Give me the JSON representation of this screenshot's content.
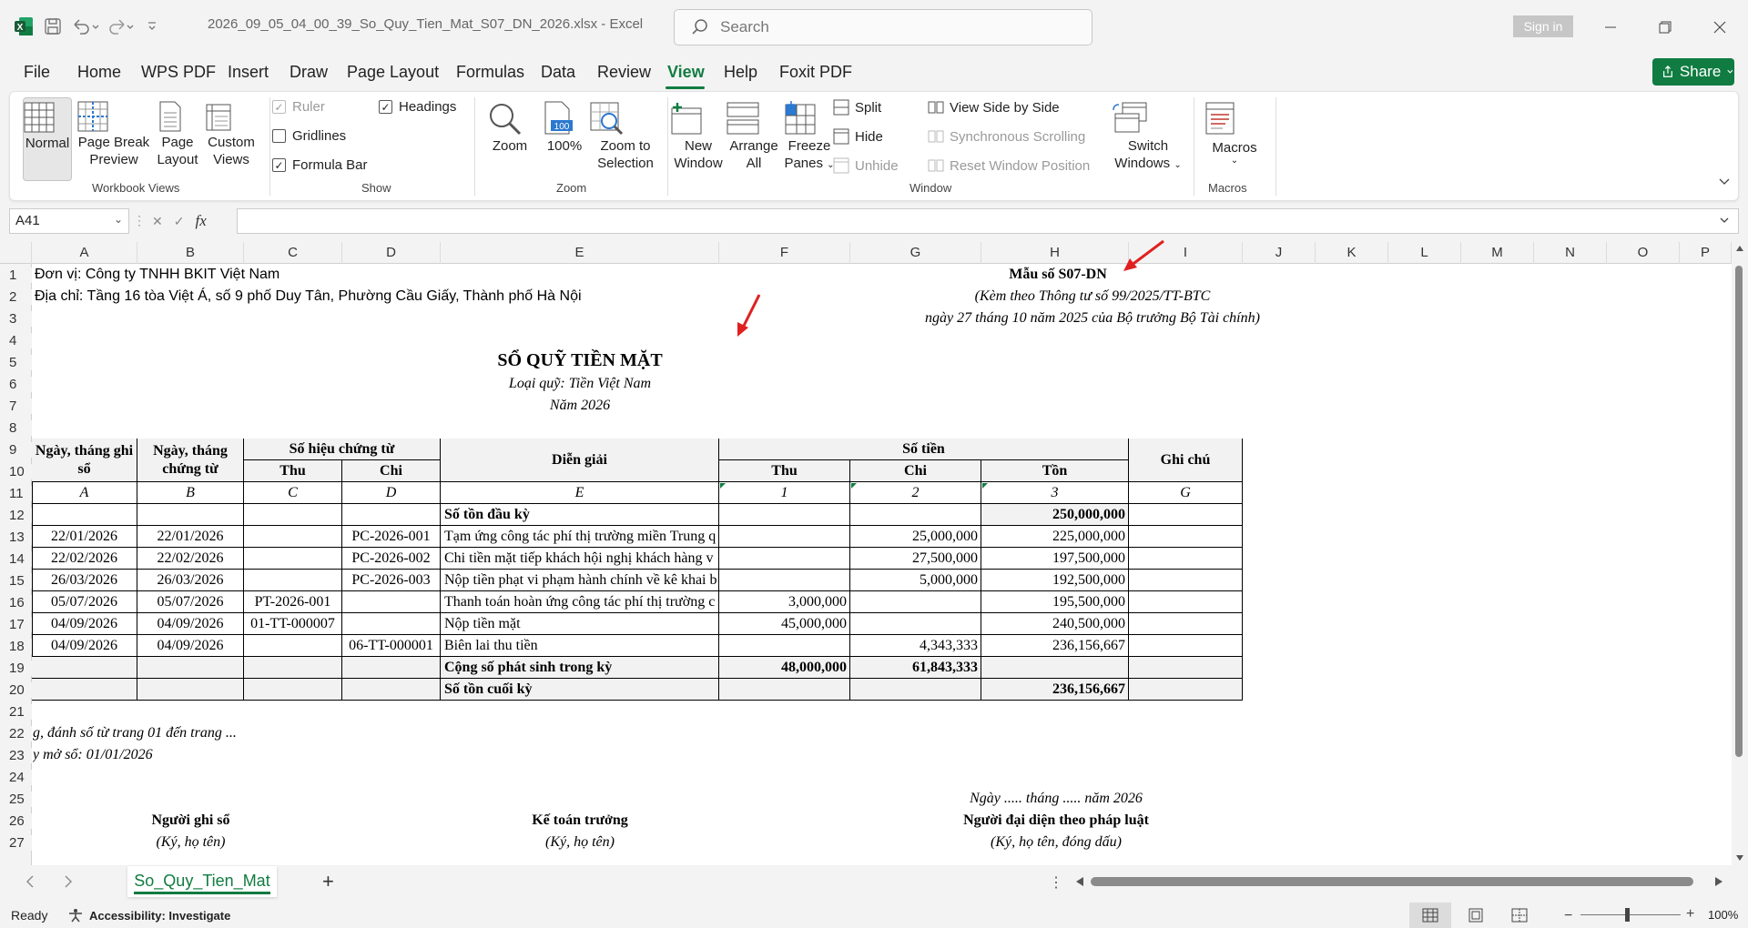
{
  "titlebar": {
    "doc_title": "2026_09_05_04_00_39_So_Quy_Tien_Mat_S07_DN_2026.xlsx  -  Excel",
    "search_placeholder": "Search",
    "sign_in": "Sign in"
  },
  "menu": {
    "items": [
      "File",
      "Home",
      "WPS PDF",
      "Insert",
      "Draw",
      "Page Layout",
      "Formulas",
      "Data",
      "Review",
      "View",
      "Help",
      "Foxit PDF"
    ],
    "active": "View",
    "share": "Share"
  },
  "ribbon": {
    "workbook_views": {
      "label": "Workbook Views",
      "normal": "Normal",
      "page_break_1": "Page Break",
      "page_break_2": "Preview",
      "page_layout_1": "Page",
      "page_layout_2": "Layout",
      "custom_1": "Custom",
      "custom_2": "Views"
    },
    "show": {
      "label": "Show",
      "ruler": "Ruler",
      "gridlines": "Gridlines",
      "formula_bar": "Formula Bar",
      "headings": "Headings"
    },
    "zoom": {
      "label": "Zoom",
      "zoom": "Zoom",
      "hundred": "100%",
      "zoom_sel_1": "Zoom to",
      "zoom_sel_2": "Selection"
    },
    "window": {
      "label": "Window",
      "new_1": "New",
      "new_2": "Window",
      "arrange_1": "Arrange",
      "arrange_2": "All",
      "freeze_1": "Freeze",
      "freeze_2": "Panes",
      "split": "Split",
      "hide": "Hide",
      "unhide": "Unhide",
      "side_by_side": "View Side by Side",
      "sync_scroll": "Synchronous Scrolling",
      "reset_pos": "Reset Window Position",
      "switch_1": "Switch",
      "switch_2": "Windows"
    },
    "macros": {
      "label": "Macros",
      "macros": "Macros"
    }
  },
  "formula_bar": {
    "name_box": "A41",
    "fx": "fx",
    "content": ""
  },
  "columns": [
    "A",
    "B",
    "C",
    "D",
    "E",
    "F",
    "G",
    "H",
    "I",
    "J",
    "K",
    "L",
    "M",
    "N",
    "O",
    "P"
  ],
  "rows": [
    "1",
    "2",
    "3",
    "4",
    "5",
    "6",
    "7",
    "8",
    "9",
    "10",
    "11",
    "12",
    "13",
    "14",
    "15",
    "16",
    "17",
    "18",
    "19",
    "20",
    "21",
    "22",
    "23",
    "24",
    "25",
    "26",
    "27"
  ],
  "sheet": {
    "unit": "Đơn vị: Công ty TNHH BKIT Việt Nam",
    "address": "Địa chỉ: Tầng 16 tòa Việt Á, số 9 phố Duy Tân, Phường Cầu Giấy, Thành phố Hà Nội",
    "form_no": "Mẫu số S07-DN",
    "circular": "(Kèm theo Thông tư số 99/2025/TT-BTC",
    "circular_date": "ngày 27 tháng 10 năm 2025 của Bộ trưởng Bộ Tài chính)",
    "title": "SỔ QUỸ TIỀN MẶT",
    "fund_type": "Loại quỹ: Tiền Việt Nam",
    "year": "Năm 2026",
    "headers": {
      "date_rec": "Ngày, tháng ghi sổ",
      "date_doc": "Ngày, tháng chứng từ",
      "doc_no": "Số hiệu chứng từ",
      "receipt": "Thu",
      "payment": "Chi",
      "desc": "Diễn giải",
      "amount": "Số tiền",
      "in": "Thu",
      "out": "Chi",
      "balance": "Tồn",
      "note": "Ghi chú"
    },
    "codes": [
      "A",
      "B",
      "C",
      "D",
      "E",
      "1",
      "2",
      "3",
      "G"
    ],
    "opening": {
      "label": "Số tồn đầu kỳ",
      "balance": "250,000,000"
    },
    "entries": [
      {
        "date_rec": "22/01/2026",
        "date_doc": "22/01/2026",
        "thu_no": "",
        "chi_no": "PC-2026-001",
        "desc": "Tạm ứng công tác phí thị trường miền Trung q",
        "in": "",
        "out": "25,000,000",
        "bal": "225,000,000"
      },
      {
        "date_rec": "22/02/2026",
        "date_doc": "22/02/2026",
        "thu_no": "",
        "chi_no": "PC-2026-002",
        "desc": "Chi tiền mặt tiếp khách hội nghị khách hàng v",
        "in": "",
        "out": "27,500,000",
        "bal": "197,500,000"
      },
      {
        "date_rec": "26/03/2026",
        "date_doc": "26/03/2026",
        "thu_no": "",
        "chi_no": "PC-2026-003",
        "desc": "Nộp tiền phạt vi phạm hành chính về kê khai b",
        "in": "",
        "out": "5,000,000",
        "bal": "192,500,000"
      },
      {
        "date_rec": "05/07/2026",
        "date_doc": "05/07/2026",
        "thu_no": "PT-2026-001",
        "chi_no": "",
        "desc": "Thanh toán hoàn ứng công tác phí thị trường c",
        "in": "3,000,000",
        "out": "",
        "bal": "195,500,000"
      },
      {
        "date_rec": "04/09/2026",
        "date_doc": "04/09/2026",
        "thu_no": "01-TT-000007",
        "chi_no": "",
        "desc": "Nộp tiền mặt",
        "in": "45,000,000",
        "out": "",
        "bal": "240,500,000"
      },
      {
        "date_rec": "04/09/2026",
        "date_doc": "04/09/2026",
        "thu_no": "",
        "chi_no": "06-TT-000001",
        "desc": "Biên lai thu tiền",
        "in": "",
        "out": "4,343,333",
        "bal": "236,156,667"
      }
    ],
    "total": {
      "label": "Cộng số phát sinh trong kỳ",
      "in": "48,000,000",
      "out": "61,843,333"
    },
    "closing": {
      "label": "Số tồn cuối kỳ",
      "balance": "236,156,667"
    },
    "note_pages": "g, đánh số từ trang 01 đến trang ...",
    "note_open": "y mở sổ: 01/01/2026",
    "date_line": "Ngày ..... tháng ..... năm 2026",
    "sig1": "Người ghi sổ",
    "sig1_sub": "(Ký, họ tên)",
    "sig2": "Kế toán trưởng",
    "sig2_sub": "(Ký, họ tên)",
    "sig3": "Người đại diện theo pháp luật",
    "sig3_sub": "(Ký, họ tên, đóng dấu)"
  },
  "tabs": {
    "sheet_name": "So_Quy_Tien_Mat",
    "add": "+"
  },
  "status": {
    "ready": "Ready",
    "accessibility": "Accessibility: Investigate",
    "zoom": "100%"
  },
  "colors": {
    "accent": "#107c41",
    "arrow": "#e02020"
  }
}
